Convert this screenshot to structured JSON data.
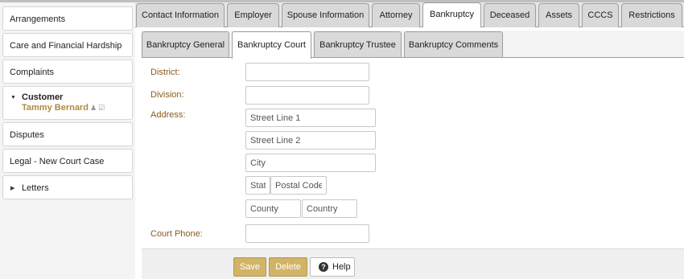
{
  "sidebar": {
    "items": [
      {
        "label": "Arrangements"
      },
      {
        "label": "Care and Financial Hardship"
      },
      {
        "label": "Complaints"
      },
      {
        "label": "Customer",
        "sub": "Tammy Bernard"
      },
      {
        "label": "Disputes"
      },
      {
        "label": "Legal - New Court Case"
      },
      {
        "label": "Letters"
      }
    ]
  },
  "tabs": [
    {
      "label": "Contact Information"
    },
    {
      "label": "Employer"
    },
    {
      "label": "Spouse Information"
    },
    {
      "label": "Attorney"
    },
    {
      "label": "Bankruptcy",
      "active": true
    },
    {
      "label": "Deceased"
    },
    {
      "label": "Assets"
    },
    {
      "label": "CCCS"
    },
    {
      "label": "Restrictions"
    }
  ],
  "subtabs": [
    {
      "label": "Bankruptcy General"
    },
    {
      "label": "Bankruptcy Court",
      "active": true
    },
    {
      "label": "Bankruptcy Trustee"
    },
    {
      "label": "Bankruptcy Comments"
    }
  ],
  "form": {
    "district_label": "District:",
    "district_value": "",
    "division_label": "Division:",
    "division_value": "",
    "address_label": "Address:",
    "street1_placeholder": "Street Line 1",
    "street2_placeholder": "Street Line 2",
    "city_placeholder": "City",
    "state_placeholder": "State",
    "postal_placeholder": "Postal Code",
    "county_placeholder": "County",
    "country_placeholder": "Country",
    "phone_label": "Court Phone:",
    "phone_value": ""
  },
  "buttons": {
    "save": "Save",
    "delete": "Delete",
    "help": "Help"
  },
  "colors": {
    "accent_gold": "#d2b466",
    "label_brown": "#8a5a1e",
    "customer_name": "#b08a3e"
  }
}
